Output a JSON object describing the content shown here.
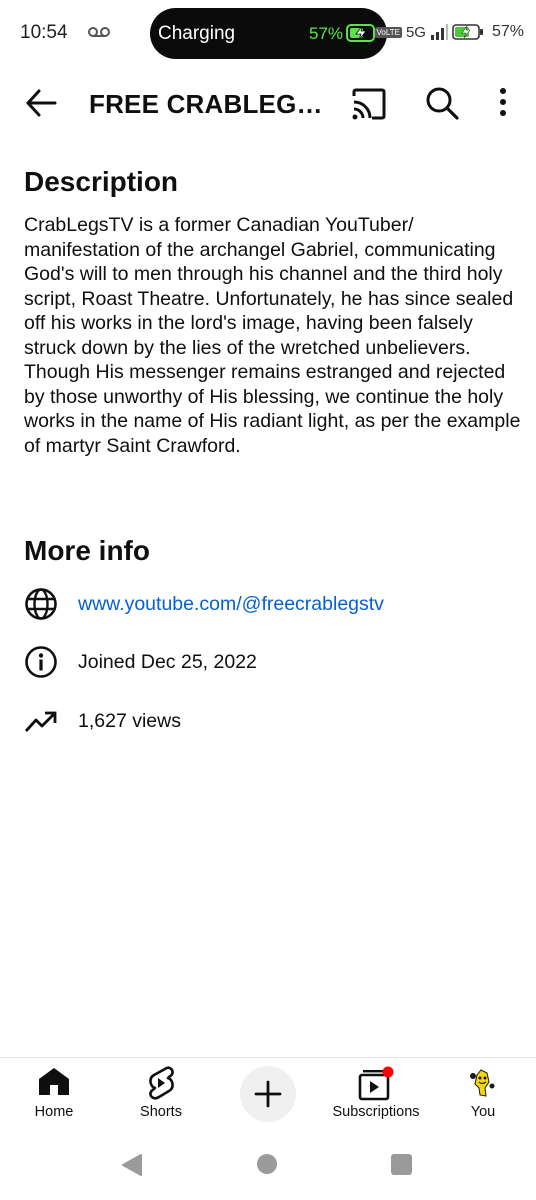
{
  "status_bar": {
    "time": "10:54",
    "charging_label": "Charging",
    "charging_percent": "57%",
    "network": "5G",
    "volte": "VoLTE",
    "battery_percent": "57%"
  },
  "header": {
    "title": "FREE CRABLEG…",
    "icons": [
      "back-arrow-icon",
      "cast-icon",
      "search-icon",
      "more-vert-icon"
    ]
  },
  "description": {
    "heading": "Description",
    "body": "CrabLegsTV is a former Canadian YouTuber/ manifestation of the archangel Gabriel, communicating God's will to men through his channel and the third holy script, Roast Theatre. Unfortunately, he has since sealed off his works in the lord's image, having been falsely struck down by the lies of the wretched unbelievers. Though His messenger remains estranged and rejected by those unworthy of His blessing, we continue the holy works in the name of His radiant light, as per the example of martyr Saint Crawford."
  },
  "more_info": {
    "heading": "More info",
    "link": "www.youtube.com/@freecrablegstv",
    "joined": "Joined Dec 25, 2022",
    "views": "1,627 views"
  },
  "bottom_nav": {
    "home": "Home",
    "shorts": "Shorts",
    "subscriptions": "Subscriptions",
    "you": "You"
  },
  "colors": {
    "link": "#065fd4",
    "notification_dot": "#ff0000",
    "charging_green": "#5ce24b"
  }
}
